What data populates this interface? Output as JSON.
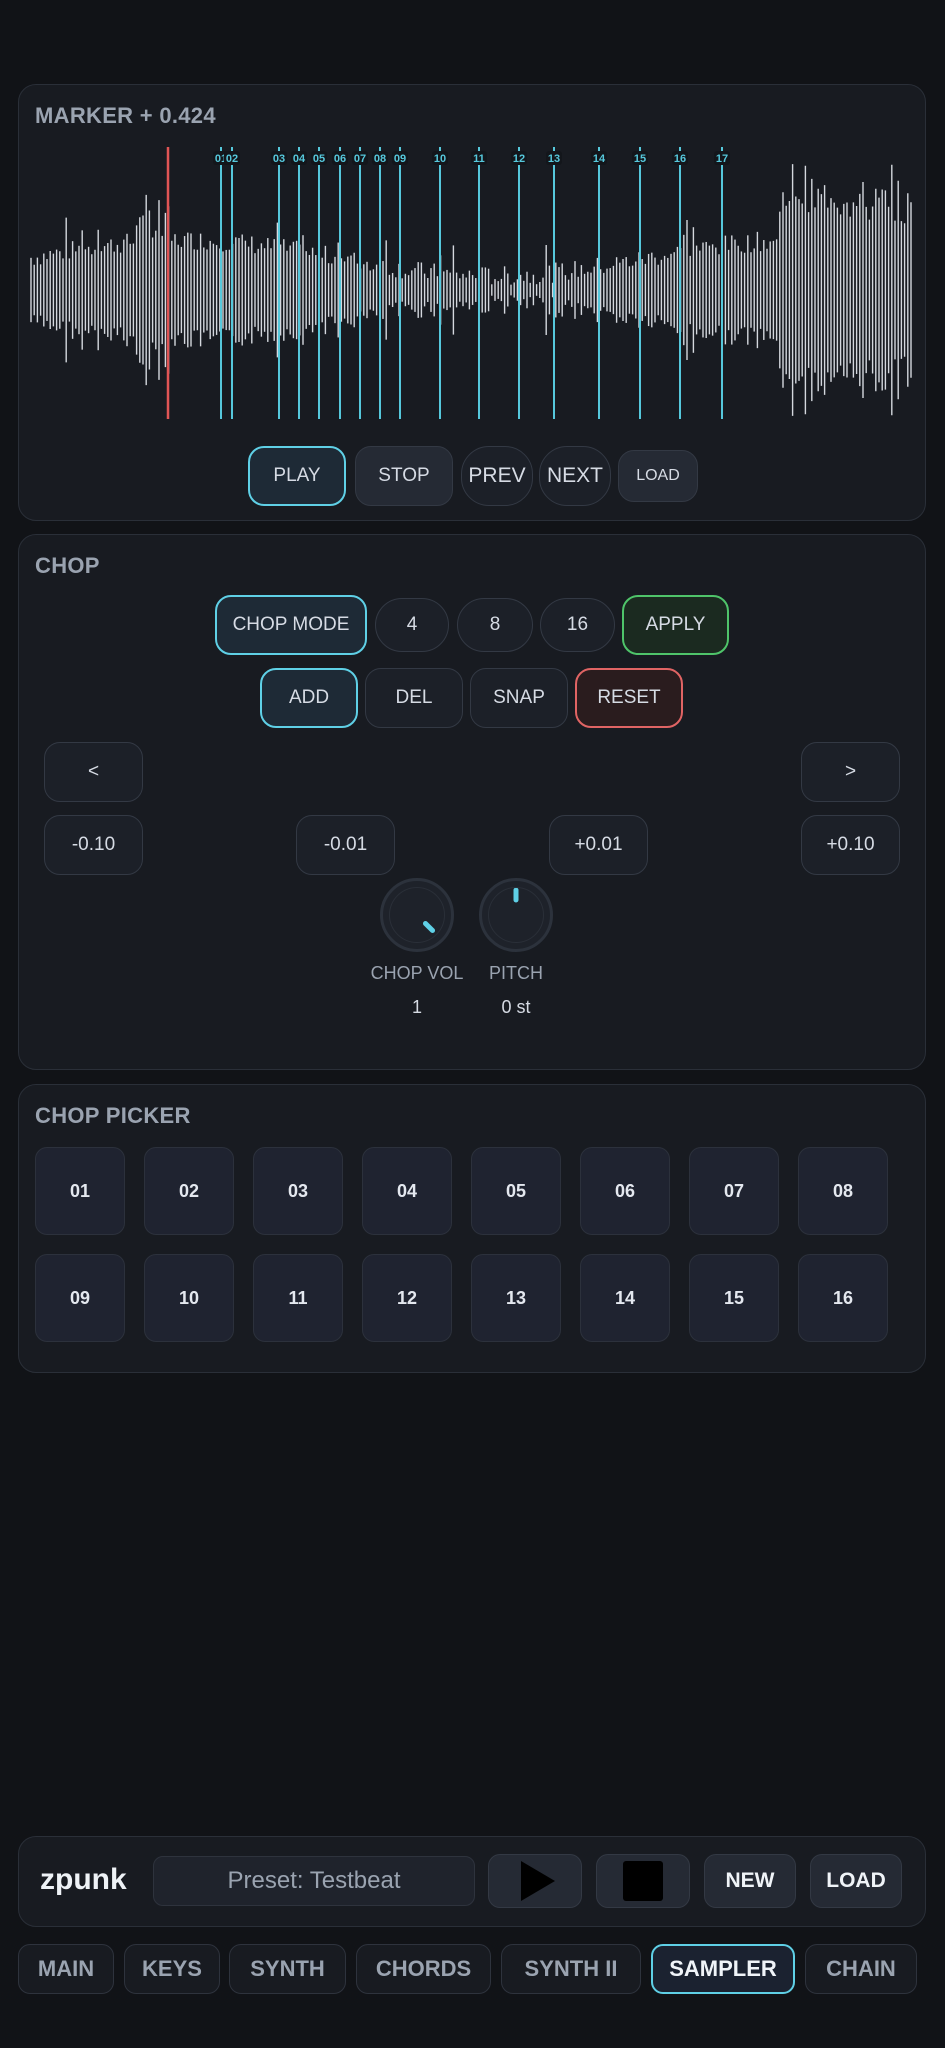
{
  "waveform": {
    "title": "MARKER + 0.424",
    "markers": [
      "01",
      "02",
      "03",
      "04",
      "05",
      "06",
      "07",
      "08",
      "09",
      "10",
      "11",
      "12",
      "13",
      "14",
      "15",
      "16",
      "17"
    ],
    "transport": {
      "play": "PLAY",
      "stop": "STOP",
      "prev": "PREV",
      "next": "NEXT",
      "load": "LOAD"
    },
    "colors": {
      "playhead": "#e05555",
      "marker": "#56c8dc",
      "wave": "#d4d8de"
    }
  },
  "chop": {
    "title": "CHOP",
    "mode": "CHOP MODE",
    "slices": [
      "4",
      "8",
      "16"
    ],
    "apply": "APPLY",
    "add": "ADD",
    "del": "DEL",
    "snap": "SNAP",
    "reset": "RESET",
    "nudge_left": "<",
    "nudge_right": ">",
    "minus_coarse": "-0.10",
    "minus_fine": "-0.01",
    "plus_fine": "+0.01",
    "plus_coarse": "+0.10",
    "knobs": {
      "vol_label": "CHOP VOL",
      "vol_value": "1",
      "pitch_label": "PITCH",
      "pitch_value": "0 st"
    }
  },
  "picker": {
    "title": "CHOP PICKER",
    "pads": [
      "01",
      "02",
      "03",
      "04",
      "05",
      "06",
      "07",
      "08",
      "09",
      "10",
      "11",
      "12",
      "13",
      "14",
      "15",
      "16"
    ]
  },
  "footer": {
    "brand": "zpunk",
    "preset": "Preset: Testbeat",
    "new": "NEW",
    "load": "LOAD",
    "play_icon": "play-icon",
    "stop_icon": "stop-icon"
  },
  "tabs": [
    "MAIN",
    "KEYS",
    "SYNTH",
    "CHORDS",
    "SYNTH II",
    "SAMPLER",
    "CHAIN"
  ],
  "active_tab": "SAMPLER"
}
